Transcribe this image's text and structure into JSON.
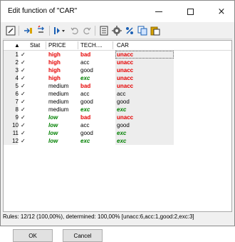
{
  "window": {
    "title": "Edit function of \"CAR\"",
    "minimize": "–",
    "close": "×"
  },
  "toolbar": [
    "edit-icon",
    "insert-row-icon",
    "add-column-icon",
    "filter-icon",
    "undo-icon",
    "redo-icon",
    "document-icon",
    "settings-icon",
    "percent-icon",
    "copy-icon",
    "paste-icon"
  ],
  "columns": {
    "sort": "▲",
    "stat": "Stat",
    "price": "PRICE",
    "tech": "TECH....",
    "car": "CAR"
  },
  "check_mark": "✓",
  "rows": [
    {
      "n": "1",
      "price": "high",
      "tech": "bad",
      "car": "unacc"
    },
    {
      "n": "2",
      "price": "high",
      "tech": "acc",
      "car": "unacc"
    },
    {
      "n": "3",
      "price": "high",
      "tech": "good",
      "car": "unacc"
    },
    {
      "n": "4",
      "price": "high",
      "tech": "exc",
      "car": "unacc"
    },
    {
      "n": "5",
      "price": "medium",
      "tech": "bad",
      "car": "unacc"
    },
    {
      "n": "6",
      "price": "medium",
      "tech": "acc",
      "car": "acc"
    },
    {
      "n": "7",
      "price": "medium",
      "tech": "good",
      "car": "good"
    },
    {
      "n": "8",
      "price": "medium",
      "tech": "exc",
      "car": "exc"
    },
    {
      "n": "9",
      "price": "low",
      "tech": "bad",
      "car": "unacc"
    },
    {
      "n": "10",
      "price": "low",
      "tech": "acc",
      "car": "good"
    },
    {
      "n": "11",
      "price": "low",
      "tech": "good",
      "car": "exc"
    },
    {
      "n": "12",
      "price": "low",
      "tech": "exc",
      "car": "exc"
    }
  ],
  "status": "Rules: 12/12 (100,00%), determined: 100,00% [unacc:6,acc:1,good:2,exc:3]",
  "buttons": {
    "ok": "OK",
    "cancel": "Cancel"
  },
  "colors": {
    "red": "#e60000",
    "green": "#008000",
    "shade": "#ededed"
  }
}
